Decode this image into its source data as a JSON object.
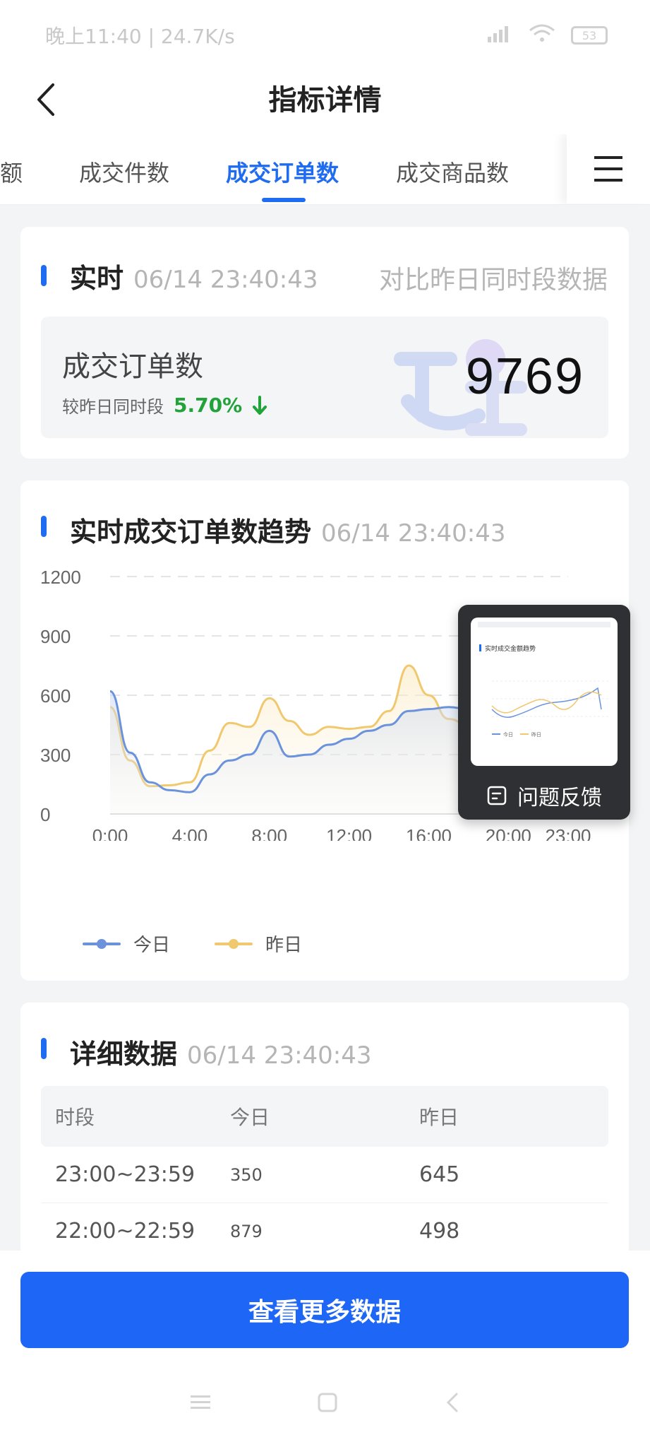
{
  "status_bar": {
    "time_speed": "晚上11:40 | 24.7K/s",
    "battery": "53"
  },
  "header": {
    "title": "指标详情"
  },
  "tabs": [
    {
      "label": "额"
    },
    {
      "label": "成交件数"
    },
    {
      "label": "成交订单数",
      "active": true
    },
    {
      "label": "成交商品数"
    }
  ],
  "realtime": {
    "title": "实时",
    "time": "06/14 23:40:43",
    "compare_label": "对比昨日同时段数据",
    "metric_name": "成交订单数",
    "compare_prefix": "较昨日同时段",
    "percent": "5.70%",
    "trend": "down",
    "value": "9769"
  },
  "trend": {
    "title": "实时成交订单数趋势",
    "time": "06/14 23:40:43"
  },
  "chart_data": {
    "type": "area",
    "x": [
      "0:00",
      "1:00",
      "2:00",
      "3:00",
      "4:00",
      "5:00",
      "6:00",
      "7:00",
      "8:00",
      "9:00",
      "10:00",
      "11:00",
      "12:00",
      "13:00",
      "14:00",
      "15:00",
      "16:00",
      "17:00",
      "18:00",
      "19:00",
      "20:00",
      "21:00",
      "22:00",
      "23:00"
    ],
    "x_tick_labels": [
      "0:00",
      "4:00",
      "8:00",
      "12:00",
      "16:00",
      "20:00",
      "23:00"
    ],
    "y_ticks": [
      "0",
      "300",
      "600",
      "900",
      "1200"
    ],
    "ylim": [
      0,
      1200
    ],
    "grid": true,
    "legend_position": "bottom-left",
    "series": [
      {
        "name": "今日",
        "color": "#6b93dc",
        "values": [
          620,
          310,
          160,
          120,
          110,
          200,
          270,
          300,
          420,
          290,
          300,
          350,
          380,
          420,
          450,
          520,
          530,
          540,
          530,
          490,
          400,
          320,
          300,
          350
        ]
      },
      {
        "name": "昨日",
        "color": "#f0c86e",
        "values": [
          540,
          270,
          140,
          145,
          160,
          320,
          460,
          440,
          585,
          470,
          400,
          440,
          430,
          440,
          520,
          750,
          600,
          480,
          450,
          470,
          500,
          520,
          500,
          645
        ]
      }
    ]
  },
  "floating_panel": {
    "label": "问题反馈",
    "thumb_title": "实时成交金额趋势",
    "thumb_legend_1": "今日",
    "thumb_legend_2": "昨日"
  },
  "detail": {
    "title": "详细数据",
    "time": "06/14 23:40:43",
    "columns": [
      "时段",
      "今日",
      "昨日"
    ],
    "rows": [
      [
        "23:00~23:59",
        "350",
        "645"
      ],
      [
        "22:00~22:59",
        "879",
        "498"
      ]
    ]
  },
  "footer": {
    "button": "查看更多数据"
  }
}
